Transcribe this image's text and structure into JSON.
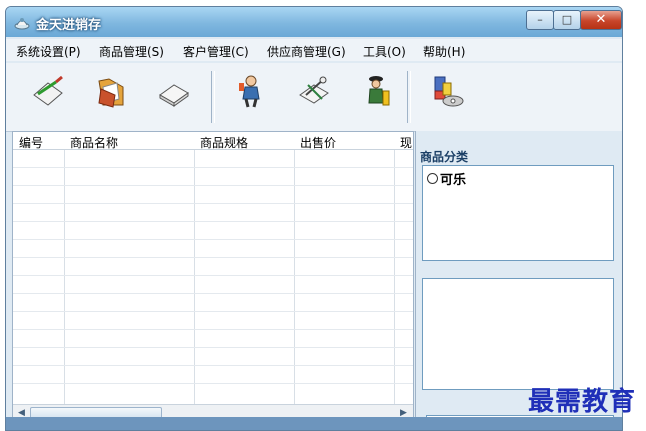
{
  "window": {
    "title": "金天进销存",
    "controls": {
      "minimize": "–",
      "maximize": "□",
      "close": "✕"
    }
  },
  "menu": {
    "items": [
      "系统设置(P)",
      "商品管理(S)",
      "客户管理(C)",
      "供应商管理(G)",
      "工具(O)",
      "帮助(H)"
    ]
  },
  "toolbar": {
    "buttons": [
      {
        "icon": "edit-icon",
        "label": ""
      },
      {
        "icon": "folder-icon",
        "label": ""
      },
      {
        "icon": "eraser-icon",
        "label": ""
      },
      {
        "icon": "customer-icon",
        "label": ""
      },
      {
        "icon": "supplier-icon",
        "label": ""
      },
      {
        "icon": "worker-icon",
        "label": ""
      },
      {
        "icon": "database-icon",
        "label": ""
      }
    ]
  },
  "grid": {
    "columns": [
      "编号",
      "商品名称",
      "商品规格",
      "出售价",
      "现"
    ]
  },
  "side": {
    "title": "商品分类",
    "categories": [
      "可乐"
    ]
  },
  "watermark": "最需教育",
  "colors": {
    "titlebar": "#7fb7df",
    "status_bar": "#6d95bd",
    "close_button": "#c8452a",
    "watermark": "#1f2fb8"
  }
}
